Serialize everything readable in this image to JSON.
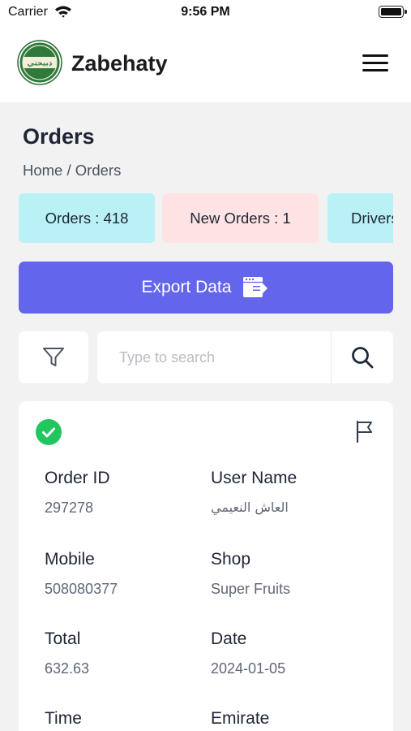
{
  "status_bar": {
    "carrier": "Carrier",
    "time": "9:56 PM"
  },
  "app": {
    "name": "Zabehaty",
    "logo_text": "ذبيحتي"
  },
  "page": {
    "title": "Orders",
    "breadcrumb_home": "Home",
    "breadcrumb_sep": " / ",
    "breadcrumb_current": "Orders"
  },
  "stats": [
    {
      "label": "Orders : 418",
      "color": "#b9f1f7"
    },
    {
      "label": "New Orders : 1",
      "color": "#fde3e4"
    },
    {
      "label": "Drivers",
      "color": "#b9f1f7"
    }
  ],
  "export": {
    "label": "Export Data",
    "color": "#6365ea"
  },
  "search": {
    "placeholder": "Type to search",
    "value": ""
  },
  "order": {
    "status_icon": "check-circle-icon",
    "status_color": "#22c55e",
    "fields": {
      "order_id": {
        "label": "Order ID",
        "value": "297278"
      },
      "user_name": {
        "label": "User Name",
        "value": "العاش النعيمي"
      },
      "mobile": {
        "label": "Mobile",
        "value": "508080377"
      },
      "shop": {
        "label": "Shop",
        "value": "Super Fruits"
      },
      "total": {
        "label": "Total",
        "value": "632.63"
      },
      "date": {
        "label": "Date",
        "value": "2024-01-05"
      },
      "time": {
        "label": "Time"
      },
      "emirate": {
        "label": "Emirate"
      }
    }
  }
}
